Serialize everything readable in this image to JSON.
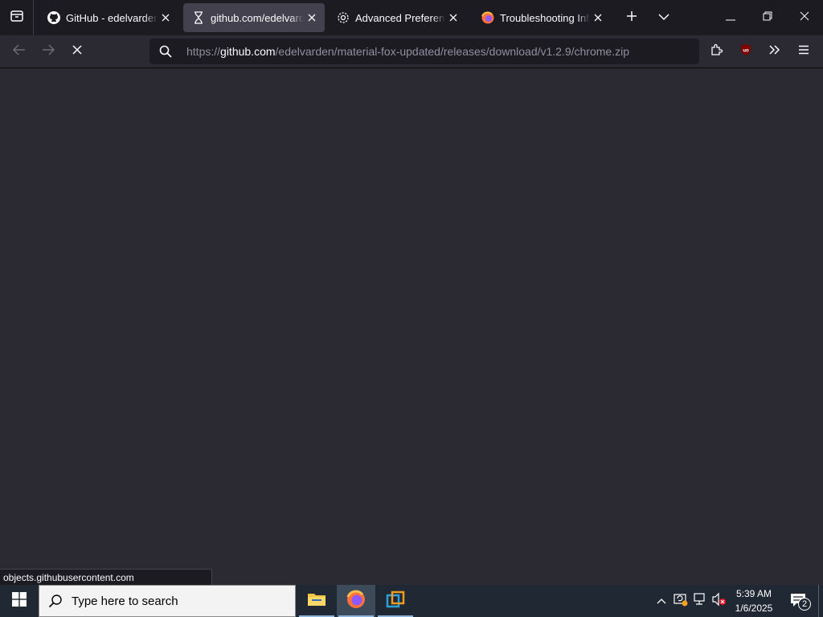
{
  "browser": {
    "tabs": [
      {
        "title": "GitHub - edelvarden/material-fox-updated",
        "favicon": "github-icon",
        "active": false
      },
      {
        "title": "github.com/edelvarden/material-fox-updated",
        "favicon": "hourglass-icon",
        "active": true
      },
      {
        "title": "Advanced Preferences",
        "favicon": "gear-icon",
        "active": false
      },
      {
        "title": "Troubleshooting Information",
        "favicon": "firefox-icon",
        "active": false
      }
    ],
    "url_prefix": "https://",
    "url_host": "github.com",
    "url_path": "/edelvarden/material-fox-updated/releases/download/v1.2.9/chrome.zip",
    "status_text": "objects.githubusercontent.com"
  },
  "taskbar": {
    "search_placeholder": "Type here to search",
    "time": "5:39 AM",
    "date": "1/6/2025",
    "notification_count": "2"
  },
  "colors": {
    "accent": "#0060df",
    "ublock": "#800000",
    "content_bg": "#2b2a33"
  }
}
